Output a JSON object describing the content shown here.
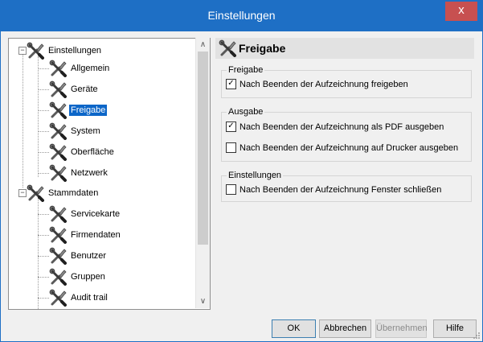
{
  "window": {
    "title": "Einstellungen",
    "close_glyph": "x"
  },
  "tree": {
    "root1": {
      "label": "Einstellungen",
      "expander": "−"
    },
    "root1_children": [
      "Allgemein",
      "Geräte",
      "Freigabe",
      "System",
      "Oberfläche",
      "Netzwerk"
    ],
    "root2": {
      "label": "Stammdaten",
      "expander": "−"
    },
    "root2_children": [
      "Servicekarte",
      "Firmendaten",
      "Benutzer",
      "Gruppen",
      "Audit trail"
    ],
    "selected": "Freigabe",
    "scroll_up": "∧",
    "scroll_down": "∨"
  },
  "panel": {
    "title": "Freigabe",
    "groups": [
      {
        "title": "Freigabe",
        "options": [
          {
            "label": "Nach Beenden der Aufzeichnung freigeben",
            "checked": true
          }
        ]
      },
      {
        "title": "Ausgabe",
        "options": [
          {
            "label": "Nach Beenden der Aufzeichnung als PDF ausgeben",
            "checked": true
          },
          {
            "label": "Nach Beenden der Aufzeichnung auf Drucker ausgeben",
            "checked": false
          }
        ]
      },
      {
        "title": "Einstellungen",
        "options": [
          {
            "label": "Nach Beenden der Aufzeichnung Fenster schließen",
            "checked": false
          }
        ]
      }
    ]
  },
  "buttons": {
    "ok": "OK",
    "cancel": "Abbrechen",
    "apply": "Übernehmen",
    "help": "Hilfe"
  },
  "icons": {
    "tool": "wrench-screwdriver-icon"
  }
}
